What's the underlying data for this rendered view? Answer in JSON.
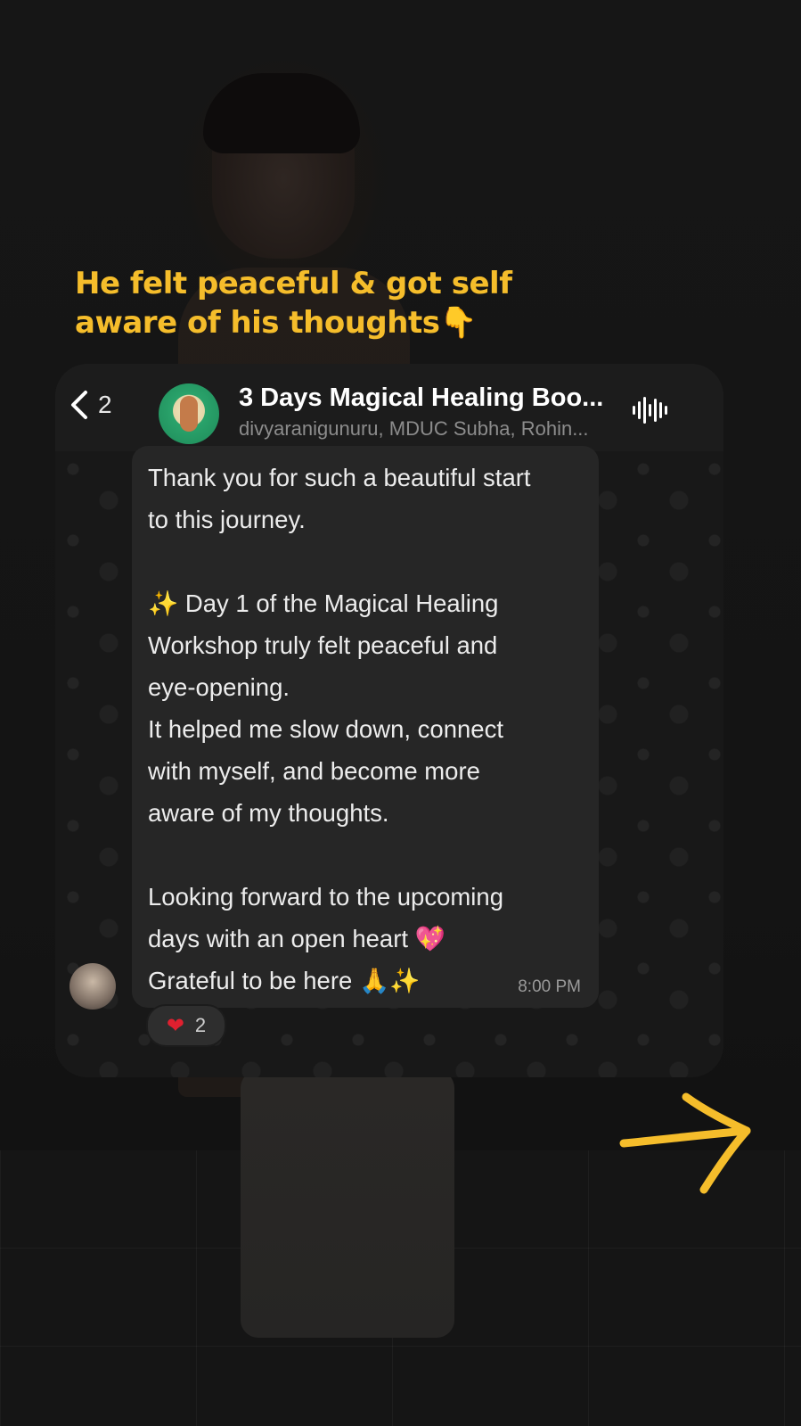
{
  "caption": {
    "line1": "He felt peaceful & got self",
    "line2": "aware of his thoughts👇"
  },
  "chat": {
    "back_count": "2",
    "group_name": "3 Days Magical Healing Boo...",
    "members": "divyaranigunuru, MDUC Subha, Rohin...",
    "message": "Thank you for such a beautiful start\nto this journey.\n\n✨ Day 1 of the Magical Healing\nWorkshop truly felt peaceful and\neye-opening.\nIt helped me slow down, connect\nwith myself, and become more\naware of my thoughts.\n\nLooking forward to the upcoming\ndays with an open heart 💖\nGrateful to be here 🙏✨",
    "time": "8:00 PM",
    "reaction_emoji": "❤",
    "reaction_count": "2"
  },
  "colors": {
    "caption": "#f5bd2b",
    "arrow": "#f5bd2b",
    "bubble": "#262626"
  },
  "icons": [
    "chevron-left-icon",
    "waveform-icon",
    "heart-icon",
    "arrow-right-icon"
  ]
}
